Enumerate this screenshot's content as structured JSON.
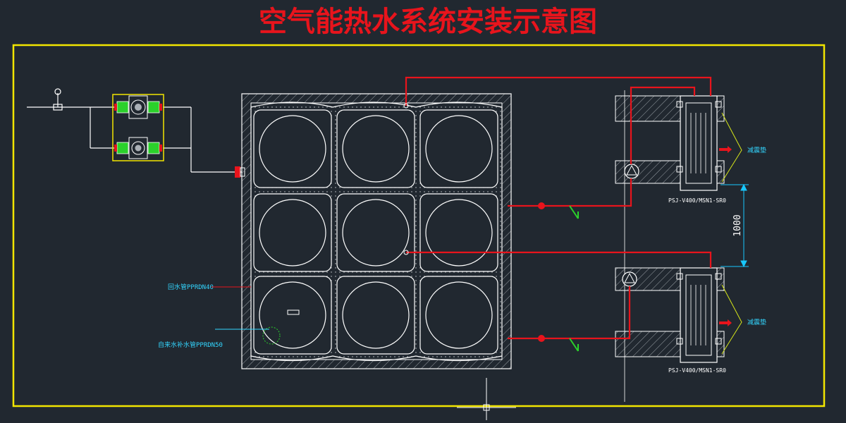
{
  "title": "空气能热水系统安装示意图",
  "annotations": {
    "return_pipe": "回水管PPRDN40",
    "tap_water_pipe": "自来水补水管PPRDN50",
    "damping_pad_top": "减震垫",
    "damping_pad_bottom": "减震垫",
    "heat_pump_top_model": "PSJ-V400/MSN1-SR0",
    "heat_pump_bottom_model": "PSJ-V400/MSN1-SR0",
    "dimension_spacing": "1000"
  },
  "colors": {
    "background": "#212830",
    "frame": "#f2e500",
    "title": "#e8141c",
    "hot_pipe": "#e8141c",
    "line": "#ffffff",
    "dimension": "#18c8ff",
    "valve_green": "#2bd12b",
    "label_cyan": "#33d6ff",
    "leader": "#e8141c",
    "damper_leader": "#d6e61a"
  },
  "icons": [
    "water-tank-grid",
    "pump-icon",
    "valve-icon",
    "check-valve-icon",
    "heat-pump-unit",
    "gauge-icon"
  ]
}
